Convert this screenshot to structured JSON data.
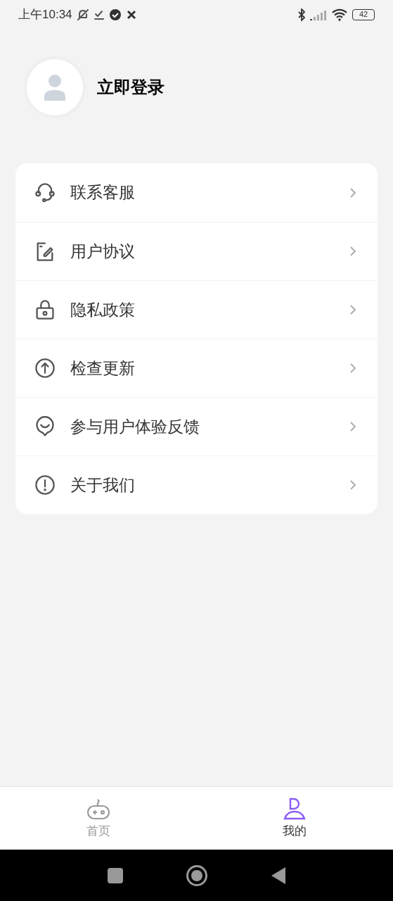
{
  "status_bar": {
    "time": "上午10:34",
    "battery": "42"
  },
  "profile": {
    "login": "立即登录"
  },
  "menu": [
    {
      "label": "联系客服"
    },
    {
      "label": "用户协议"
    },
    {
      "label": "隐私政策"
    },
    {
      "label": "检查更新"
    },
    {
      "label": "参与用户体验反馈"
    },
    {
      "label": "关于我们"
    }
  ],
  "tabs": [
    {
      "label": "首页",
      "selected": false
    },
    {
      "label": "我的",
      "selected": true
    }
  ]
}
